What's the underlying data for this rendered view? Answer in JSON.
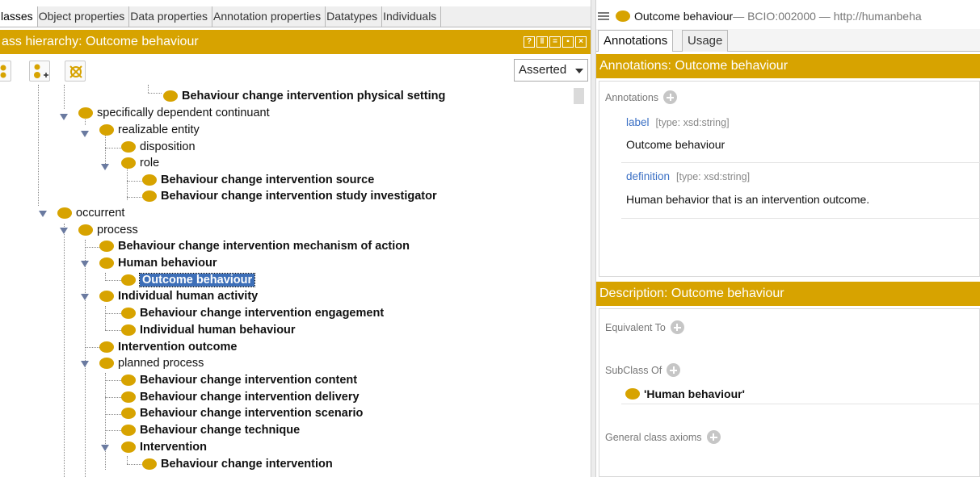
{
  "tabs": [
    "lasses",
    "Object properties",
    "Data properties",
    "Annotation properties",
    "Datatypes",
    "Individuals"
  ],
  "class_hierarchy": {
    "title": "ass hierarchy: Outcome behaviour",
    "view_mode": "Asserted",
    "window_controls": [
      "restore-icon",
      "split-vertical-icon",
      "split-horizontal-icon",
      "maximize-icon",
      "close-icon"
    ],
    "toolbar_icons": [
      "add-subclass-icon",
      "add-sibling-icon",
      "delete-class-icon"
    ],
    "tree": [
      {
        "label": "Behaviour change intervention physical setting",
        "bold": true
      },
      {
        "label": "specifically dependent continuant",
        "bold": false
      },
      {
        "label": "realizable entity",
        "bold": false
      },
      {
        "label": "disposition",
        "bold": false
      },
      {
        "label": "role",
        "bold": false
      },
      {
        "label": "Behaviour change intervention source",
        "bold": true
      },
      {
        "label": "Behaviour change intervention study investigator",
        "bold": true
      },
      {
        "label": "occurrent",
        "bold": false
      },
      {
        "label": "process",
        "bold": false
      },
      {
        "label": "Behaviour change intervention mechanism of action",
        "bold": true
      },
      {
        "label": "Human behaviour",
        "bold": true
      },
      {
        "label": "Outcome behaviour",
        "bold": true,
        "selected": true
      },
      {
        "label": "Individual human activity",
        "bold": true
      },
      {
        "label": "Behaviour change intervention engagement",
        "bold": true
      },
      {
        "label": "Individual human behaviour",
        "bold": true
      },
      {
        "label": "Intervention outcome",
        "bold": true
      },
      {
        "label": "planned process",
        "bold": false
      },
      {
        "label": "Behaviour change intervention content",
        "bold": true
      },
      {
        "label": "Behaviour change intervention delivery",
        "bold": true
      },
      {
        "label": "Behaviour change intervention scenario",
        "bold": true
      },
      {
        "label": "Behaviour change technique",
        "bold": true
      },
      {
        "label": "Intervention",
        "bold": true
      },
      {
        "label": "Behaviour change intervention",
        "bold": true
      }
    ]
  },
  "entity": {
    "name": "Outcome behaviour",
    "rest": " — BCIO:002000 — http://humanbeha"
  },
  "right_tabs": [
    "Annotations",
    "Usage"
  ],
  "annotations": {
    "title": "Annotations: Outcome behaviour",
    "header": "Annotations",
    "items": [
      {
        "property": "label",
        "type": "[type: xsd:string]",
        "value": "Outcome behaviour"
      },
      {
        "property": "definition",
        "type": "[type: xsd:string]",
        "value": "Human behavior that is an intervention outcome."
      }
    ]
  },
  "description": {
    "title": "Description: Outcome behaviour",
    "equivalent_to": "Equivalent To",
    "subclass_of": "SubClass Of",
    "subclass_items": [
      "'Human behaviour'"
    ],
    "general_axioms": "General class axioms"
  },
  "colors": {
    "accent": "#d7a300",
    "selection": "#3d6fb8",
    "link": "#3a6fc4"
  }
}
